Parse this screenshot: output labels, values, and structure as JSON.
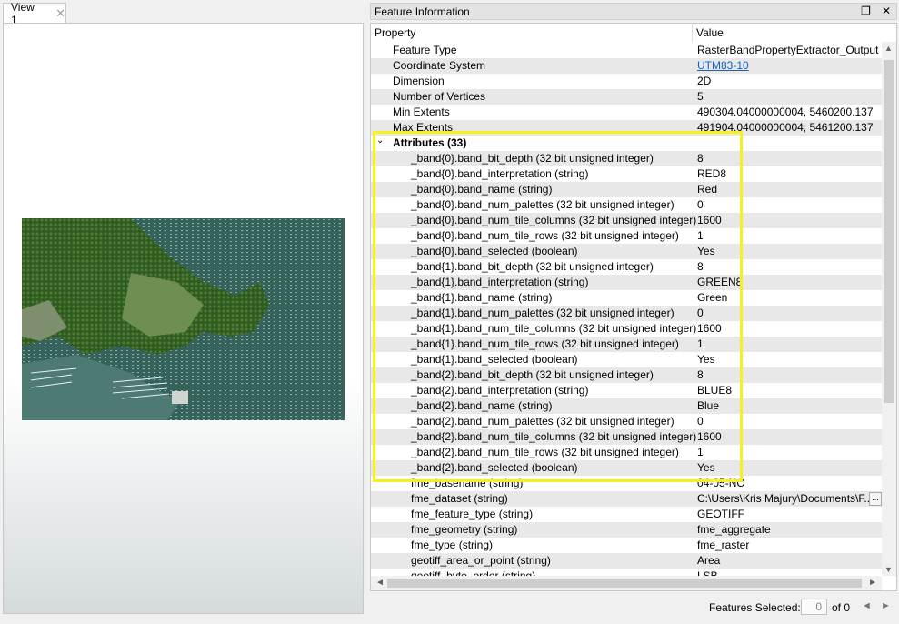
{
  "view_tab": {
    "label": "View 1",
    "close": "✕"
  },
  "panel": {
    "title": "Feature Information",
    "restore_icon": "❐",
    "close_icon": "✕"
  },
  "table": {
    "col_property": "Property",
    "col_value": "Value",
    "top_rows": [
      {
        "p": "Feature Type",
        "v": "RasterBandPropertyExtractor_Output"
      },
      {
        "p": "Coordinate System",
        "v": "UTM83-10",
        "link": true
      },
      {
        "p": "Dimension",
        "v": "2D"
      },
      {
        "p": "Number of Vertices",
        "v": "5"
      },
      {
        "p": "Min Extents",
        "v": "490304.04000000004, 5460200.137"
      },
      {
        "p": "Max Extents",
        "v": "491904.04000000004, 5461200.137"
      }
    ],
    "group": {
      "label": "Attributes (33)",
      "chevron": "⌄"
    },
    "attr_rows": [
      {
        "p": "_band{0}.band_bit_depth (32 bit unsigned integer)",
        "v": "8"
      },
      {
        "p": "_band{0}.band_interpretation (string)",
        "v": "RED8"
      },
      {
        "p": "_band{0}.band_name (string)",
        "v": "Red"
      },
      {
        "p": "_band{0}.band_num_palettes (32 bit unsigned integer)",
        "v": "0"
      },
      {
        "p": "_band{0}.band_num_tile_columns (32 bit unsigned integer)",
        "v": "1600"
      },
      {
        "p": "_band{0}.band_num_tile_rows (32 bit unsigned integer)",
        "v": "1"
      },
      {
        "p": "_band{0}.band_selected (boolean)",
        "v": "Yes"
      },
      {
        "p": "_band{1}.band_bit_depth (32 bit unsigned integer)",
        "v": "8"
      },
      {
        "p": "_band{1}.band_interpretation (string)",
        "v": "GREEN8"
      },
      {
        "p": "_band{1}.band_name (string)",
        "v": "Green"
      },
      {
        "p": "_band{1}.band_num_palettes (32 bit unsigned integer)",
        "v": "0"
      },
      {
        "p": "_band{1}.band_num_tile_columns (32 bit unsigned integer)",
        "v": "1600"
      },
      {
        "p": "_band{1}.band_num_tile_rows (32 bit unsigned integer)",
        "v": "1"
      },
      {
        "p": "_band{1}.band_selected (boolean)",
        "v": "Yes"
      },
      {
        "p": "_band{2}.band_bit_depth (32 bit unsigned integer)",
        "v": "8"
      },
      {
        "p": "_band{2}.band_interpretation (string)",
        "v": "BLUE8"
      },
      {
        "p": "_band{2}.band_name (string)",
        "v": "Blue"
      },
      {
        "p": "_band{2}.band_num_palettes (32 bit unsigned integer)",
        "v": "0"
      },
      {
        "p": "_band{2}.band_num_tile_columns (32 bit unsigned integer)",
        "v": "1600"
      },
      {
        "p": "_band{2}.band_num_tile_rows (32 bit unsigned integer)",
        "v": "1"
      },
      {
        "p": "_band{2}.band_selected (boolean)",
        "v": "Yes"
      },
      {
        "p": "fme_basename (string)",
        "v": "04-05-NO"
      },
      {
        "p": "fme_dataset (string)",
        "v": "C:\\Users\\Kris Majury\\Documents\\F...",
        "ellipsis": true
      },
      {
        "p": "fme_feature_type (string)",
        "v": "GEOTIFF"
      },
      {
        "p": "fme_geometry (string)",
        "v": "fme_aggregate"
      },
      {
        "p": "fme_type (string)",
        "v": "fme_raster"
      },
      {
        "p": "geotiff_area_or_point (string)",
        "v": "Area"
      },
      {
        "p": "geotiff_byte_order (string)",
        "v": "LSB"
      }
    ]
  },
  "status": {
    "label": "Features Selected:",
    "selected": "0",
    "of": "of 0"
  },
  "icons": {
    "prev": "◄",
    "next": "►",
    "up": "▲",
    "down": "▼",
    "left": "◄",
    "right": "►"
  }
}
